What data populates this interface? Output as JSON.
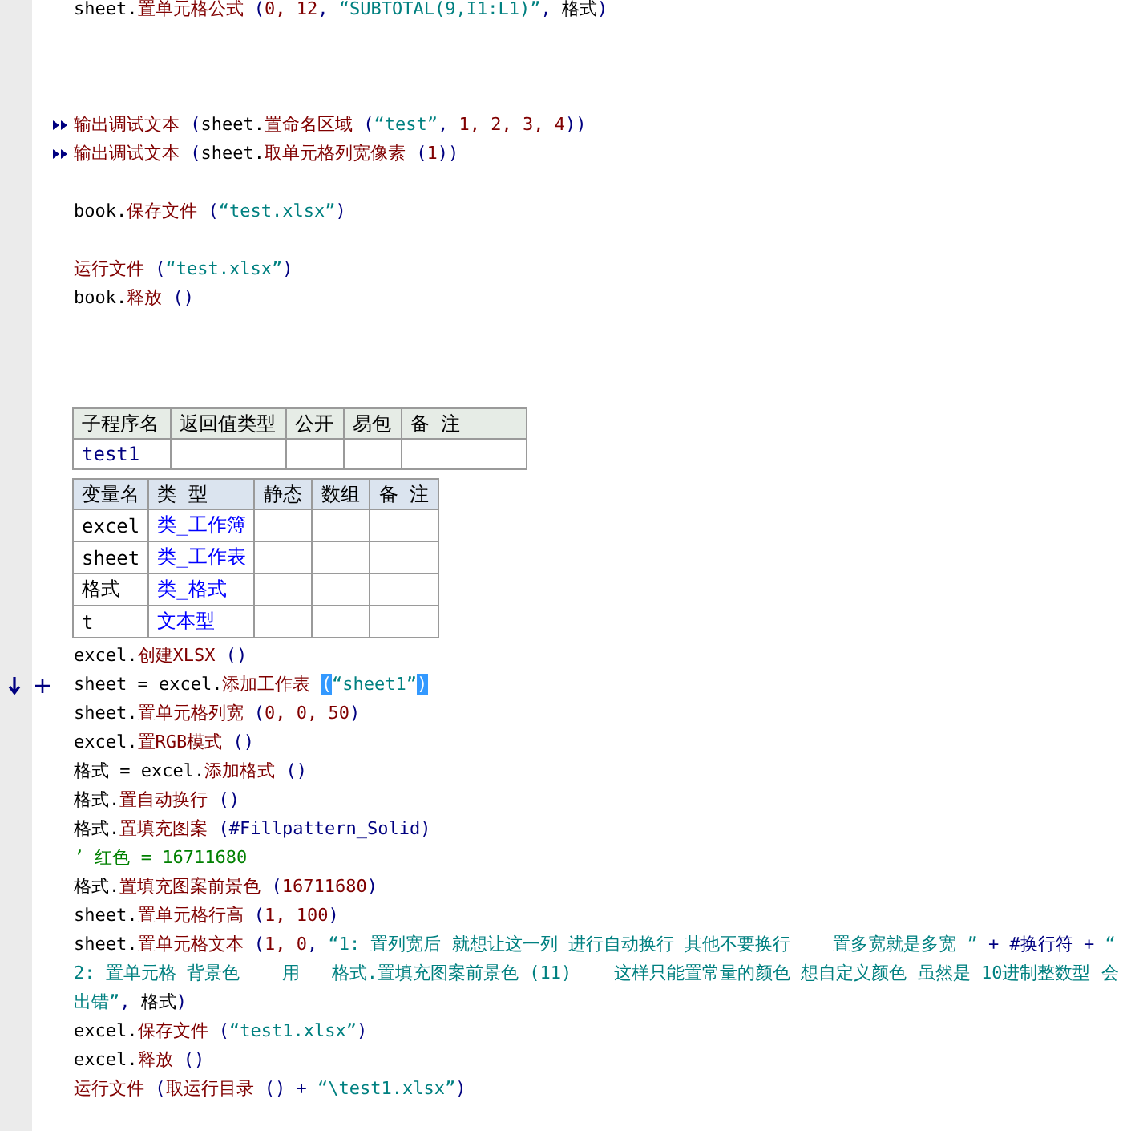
{
  "blocks": [
    {
      "kind": "code",
      "segments": [
        {
          "kind": "obj",
          "text": "sheet."
        },
        {
          "kind": "cmd",
          "text": "置单元格公式"
        },
        {
          "kind": "punct",
          "text": " ("
        },
        {
          "kind": "num",
          "text": "0, 12"
        },
        {
          "kind": "punct",
          "text": ", "
        },
        {
          "kind": "str",
          "text": "“SUBTOTAL(9,I1:L1)”"
        },
        {
          "kind": "punct",
          "text": ", "
        },
        {
          "kind": "obj",
          "text": "格式"
        },
        {
          "kind": "punct",
          "text": ")"
        }
      ]
    },
    {
      "kind": "blank"
    },
    {
      "kind": "blank"
    },
    {
      "kind": "blank"
    },
    {
      "kind": "debug",
      "segments": [
        {
          "kind": "cmd",
          "text": "输出调试文本"
        },
        {
          "kind": "punct",
          "text": " ("
        },
        {
          "kind": "obj",
          "text": "sheet."
        },
        {
          "kind": "cmd",
          "text": "置命名区域"
        },
        {
          "kind": "punct",
          "text": " ("
        },
        {
          "kind": "str",
          "text": "“test”"
        },
        {
          "kind": "punct",
          "text": ", "
        },
        {
          "kind": "num",
          "text": "1, 2, 3, 4"
        },
        {
          "kind": "punct",
          "text": "))"
        }
      ]
    },
    {
      "kind": "debug",
      "segments": [
        {
          "kind": "cmd",
          "text": "输出调试文本"
        },
        {
          "kind": "punct",
          "text": " ("
        },
        {
          "kind": "obj",
          "text": "sheet."
        },
        {
          "kind": "cmd",
          "text": "取单元格列宽像素"
        },
        {
          "kind": "punct",
          "text": " ("
        },
        {
          "kind": "num",
          "text": "1"
        },
        {
          "kind": "punct",
          "text": "))"
        }
      ]
    },
    {
      "kind": "blank"
    },
    {
      "kind": "code",
      "segments": [
        {
          "kind": "obj",
          "text": "book."
        },
        {
          "kind": "cmd",
          "text": "保存文件"
        },
        {
          "kind": "punct",
          "text": " ("
        },
        {
          "kind": "str",
          "text": "“test.xlsx”"
        },
        {
          "kind": "punct",
          "text": ")"
        }
      ]
    },
    {
      "kind": "blank"
    },
    {
      "kind": "code",
      "segments": [
        {
          "kind": "cmd",
          "text": "运行文件"
        },
        {
          "kind": "punct",
          "text": " ("
        },
        {
          "kind": "str",
          "text": "“test.xlsx”"
        },
        {
          "kind": "punct",
          "text": ")"
        }
      ]
    },
    {
      "kind": "code",
      "segments": [
        {
          "kind": "obj",
          "text": "book."
        },
        {
          "kind": "cmd",
          "text": "释放"
        },
        {
          "kind": "punct",
          "text": " ()"
        }
      ]
    },
    {
      "kind": "blank"
    },
    {
      "kind": "blank"
    },
    {
      "kind": "blank"
    },
    {
      "kind": "sub_table",
      "columns": [
        "子程序名",
        "返回值类型",
        "公开",
        "易包",
        "备 注"
      ],
      "rows": [
        [
          "test1",
          "",
          "",
          "",
          ""
        ]
      ]
    },
    {
      "kind": "var_table",
      "columns": [
        "变量名",
        "类 型",
        "静态",
        "数组",
        "备 注"
      ],
      "rows": [
        [
          "excel",
          "类_工作簿",
          "",
          "",
          ""
        ],
        [
          "sheet",
          "类_工作表",
          "",
          "",
          ""
        ],
        [
          "格式",
          "类_格式",
          "",
          "",
          ""
        ],
        [
          "t",
          "文本型",
          "",
          "",
          ""
        ]
      ]
    },
    {
      "kind": "code",
      "segments": [
        {
          "kind": "obj",
          "text": "excel."
        },
        {
          "kind": "cmd",
          "text": "创建XLSX"
        },
        {
          "kind": "punct",
          "text": " ()"
        }
      ]
    },
    {
      "kind": "current",
      "segments": [
        {
          "kind": "obj",
          "text": "sheet = excel."
        },
        {
          "kind": "cmd",
          "text": "添加工作表 "
        },
        {
          "kind": "sel",
          "text": "("
        },
        {
          "kind": "str",
          "text": "“sheet1”"
        },
        {
          "kind": "sel",
          "text": ")"
        }
      ]
    },
    {
      "kind": "code",
      "segments": [
        {
          "kind": "obj",
          "text": "sheet."
        },
        {
          "kind": "cmd",
          "text": "置单元格列宽"
        },
        {
          "kind": "punct",
          "text": " ("
        },
        {
          "kind": "num",
          "text": "0, 0, 50"
        },
        {
          "kind": "punct",
          "text": ")"
        }
      ]
    },
    {
      "kind": "code",
      "segments": [
        {
          "kind": "obj",
          "text": "excel."
        },
        {
          "kind": "cmd",
          "text": "置RGB模式"
        },
        {
          "kind": "punct",
          "text": " ()"
        }
      ]
    },
    {
      "kind": "code",
      "segments": [
        {
          "kind": "obj",
          "text": "格式 = excel."
        },
        {
          "kind": "cmd",
          "text": "添加格式"
        },
        {
          "kind": "punct",
          "text": " ()"
        }
      ]
    },
    {
      "kind": "code",
      "segments": [
        {
          "kind": "obj",
          "text": "格式."
        },
        {
          "kind": "cmd",
          "text": "置自动换行"
        },
        {
          "kind": "punct",
          "text": " ()"
        }
      ]
    },
    {
      "kind": "code",
      "segments": [
        {
          "kind": "obj",
          "text": "格式."
        },
        {
          "kind": "cmd",
          "text": "置填充图案"
        },
        {
          "kind": "punct",
          "text": " (#Fillpattern_Solid)"
        }
      ]
    },
    {
      "kind": "code",
      "segments": [
        {
          "kind": "cmt",
          "text": "’ 红色 = 16711680"
        }
      ]
    },
    {
      "kind": "code",
      "segments": [
        {
          "kind": "obj",
          "text": "格式."
        },
        {
          "kind": "cmd",
          "text": "置填充图案前景色"
        },
        {
          "kind": "punct",
          "text": " ("
        },
        {
          "kind": "num",
          "text": "16711680"
        },
        {
          "kind": "punct",
          "text": ")"
        }
      ]
    },
    {
      "kind": "code",
      "segments": [
        {
          "kind": "obj",
          "text": "sheet."
        },
        {
          "kind": "cmd",
          "text": "置单元格行高"
        },
        {
          "kind": "punct",
          "text": " ("
        },
        {
          "kind": "num",
          "text": "1, 100"
        },
        {
          "kind": "punct",
          "text": ")"
        }
      ]
    },
    {
      "kind": "code",
      "segments": [
        {
          "kind": "obj",
          "text": "sheet."
        },
        {
          "kind": "cmd",
          "text": "置单元格文本"
        },
        {
          "kind": "punct",
          "text": " ("
        },
        {
          "kind": "num",
          "text": "1, 0"
        },
        {
          "kind": "punct",
          "text": ", "
        },
        {
          "kind": "str",
          "text": "“1: 置列宽后 就想让这一列 进行自动换行 其他不要换行    置多宽就是多宽 ”"
        },
        {
          "kind": "punct",
          "text": " + #换行符 + "
        },
        {
          "kind": "str",
          "text": "“ 2: 置单元格 背景色    用   格式.置填充图案前景色 (11)    这样只能置常量的颜色 想自定义颜色 虽然是 10进制整数型 会出错”"
        },
        {
          "kind": "punct",
          "text": ", "
        },
        {
          "kind": "obj",
          "text": "格式"
        },
        {
          "kind": "punct",
          "text": ")"
        }
      ]
    },
    {
      "kind": "code",
      "segments": [
        {
          "kind": "obj",
          "text": "excel."
        },
        {
          "kind": "cmd",
          "text": "保存文件"
        },
        {
          "kind": "punct",
          "text": " ("
        },
        {
          "kind": "str",
          "text": "“test1.xlsx”"
        },
        {
          "kind": "punct",
          "text": ")"
        }
      ]
    },
    {
      "kind": "code",
      "segments": [
        {
          "kind": "obj",
          "text": "excel."
        },
        {
          "kind": "cmd",
          "text": "释放"
        },
        {
          "kind": "punct",
          "text": " ()"
        }
      ]
    },
    {
      "kind": "code",
      "segments": [
        {
          "kind": "cmd",
          "text": "运行文件"
        },
        {
          "kind": "punct",
          "text": " ("
        },
        {
          "kind": "cmd",
          "text": "取运行目录"
        },
        {
          "kind": "punct",
          "text": " () + "
        },
        {
          "kind": "str",
          "text": "“\\test1.xlsx”"
        },
        {
          "kind": "punct",
          "text": ")"
        }
      ]
    }
  ]
}
